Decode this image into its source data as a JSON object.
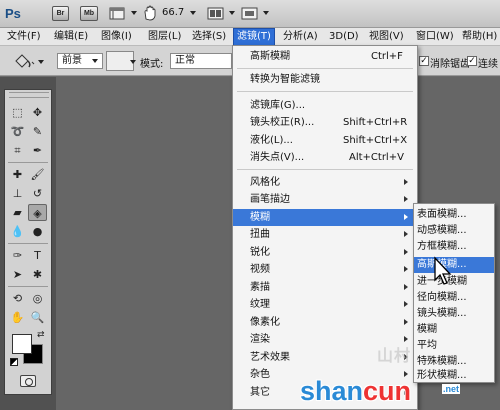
{
  "app": {
    "logo": "Ps",
    "bridge_label": "Br",
    "minibridge_label": "Mb",
    "zoom": "66.7"
  },
  "menubar": {
    "items": [
      "文件(F)",
      "编辑(E)",
      "图像(I)",
      "图层(L)",
      "选择(S)",
      "滤镜(T)",
      "分析(A)",
      "3D(D)",
      "视图(V)",
      "窗口(W)",
      "帮助(H)"
    ],
    "active_index": 5
  },
  "options": {
    "mode_label": "前景",
    "blend_label": "模式:",
    "blend_value": "正常",
    "antialias_label": "消除锯齿",
    "antialias_checked": true,
    "contiguous_label": "连续",
    "contiguous_checked": true
  },
  "filter_menu": {
    "items": [
      {
        "label": "高斯模糊",
        "shortcut": "Ctrl+F"
      },
      {
        "label": "转换为智能滤镜",
        "shortcut": ""
      },
      {
        "label": "滤镜库(G)...",
        "shortcut": ""
      },
      {
        "label": "镜头校正(R)...",
        "shortcut": "Shift+Ctrl+R"
      },
      {
        "label": "液化(L)...",
        "shortcut": "Shift+Ctrl+X"
      },
      {
        "label": "消失点(V)...",
        "shortcut": "Alt+Ctrl+V"
      },
      {
        "label": "风格化",
        "submenu": true
      },
      {
        "label": "画笔描边",
        "submenu": true
      },
      {
        "label": "模糊",
        "submenu": true,
        "highlighted": true
      },
      {
        "label": "扭曲",
        "submenu": true
      },
      {
        "label": "锐化",
        "submenu": true
      },
      {
        "label": "视频",
        "submenu": true
      },
      {
        "label": "素描",
        "submenu": true
      },
      {
        "label": "纹理",
        "submenu": true
      },
      {
        "label": "像素化",
        "submenu": true
      },
      {
        "label": "渲染",
        "submenu": true
      },
      {
        "label": "艺术效果",
        "submenu": true
      },
      {
        "label": "杂色",
        "submenu": true
      },
      {
        "label": "其它",
        "submenu": true
      }
    ]
  },
  "blur_submenu": {
    "items": [
      {
        "label": "表面模糊..."
      },
      {
        "label": "动感模糊..."
      },
      {
        "label": "方框模糊..."
      },
      {
        "label": "高斯模糊...",
        "highlighted": true
      },
      {
        "label": "进一步模糊"
      },
      {
        "label": "径向模糊..."
      },
      {
        "label": "镜头模糊..."
      },
      {
        "label": "模糊"
      },
      {
        "label": "平均"
      },
      {
        "label": "特殊模糊..."
      },
      {
        "label": "形状模糊..."
      }
    ]
  },
  "watermark": {
    "text_blue": "shan",
    "text_red": "cun",
    "suffix": ".net",
    "chinese": "山村",
    "colors": {
      "blue": "#2a8ad6",
      "red": "#e33333"
    }
  },
  "colors": {
    "menu_highlight": "#3a78d8",
    "active_menu": "#2f6fd6",
    "foreground_swatch": "#ffffff",
    "background_swatch": "#000000"
  }
}
